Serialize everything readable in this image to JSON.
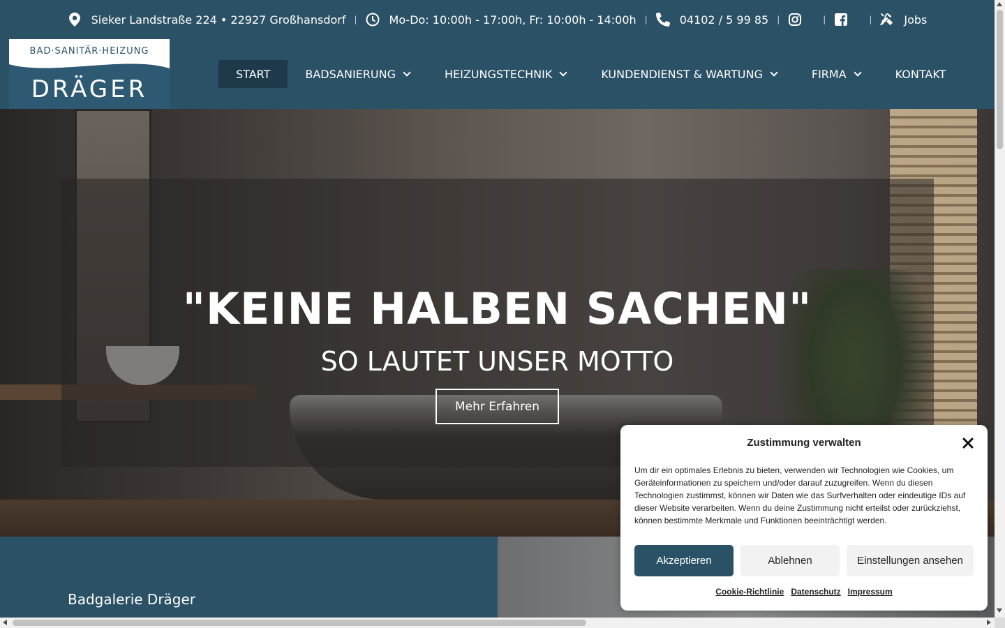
{
  "topbar": {
    "address": "Sieker Landstraße 224 • 22927 Großhansdorf",
    "hours": "Mo-Do: 10:00h - 17:00h, Fr: 10:00h - 14:00h",
    "phone": "04102 / 5 99 85",
    "jobs": "Jobs",
    "icons": [
      "map-pin-icon",
      "clock-icon",
      "phone-icon",
      "instagram-icon",
      "facebook-icon",
      "tools-icon"
    ]
  },
  "logo": {
    "small": "BAD·SANITÄR·HEIZUNG",
    "big": "DRÄGER"
  },
  "nav": {
    "items": [
      {
        "label": "START",
        "active": true
      },
      {
        "label": "BADSANIERUNG",
        "dropdown": true
      },
      {
        "label": "HEIZUNGSTECHNIK",
        "dropdown": true
      },
      {
        "label": "KUNDENDIENST & WARTUNG",
        "dropdown": true
      },
      {
        "label": "FIRMA",
        "dropdown": true
      },
      {
        "label": "KONTAKT"
      }
    ]
  },
  "hero": {
    "title": "\"KEINE HALBEN SACHEN\"",
    "subtitle": "SO LAUTET UNSER MOTTO",
    "button": "Mehr Erfahren"
  },
  "section": {
    "title": "Badgalerie Dräger"
  },
  "cookie": {
    "title": "Zustimmung verwalten",
    "text": "Um dir ein optimales Erlebnis zu bieten, verwenden wir Technologien wie Cookies, um Geräteinformationen zu speichern und/oder darauf zuzugreifen. Wenn du diesen Technologien zustimmst, können wir Daten wie das Surfverhalten oder eindeutige IDs auf dieser Website verarbeiten. Wenn du deine Zustimmung nicht erteilst oder zurückziehst, können bestimmte Merkmale und Funktionen beeinträchtigt werden.",
    "accept": "Akzeptieren",
    "deny": "Ablehnen",
    "settings": "Einstellungen ansehen",
    "links": [
      "Cookie-Richtlinie",
      "Datenschutz",
      "Impressum"
    ]
  },
  "colors": {
    "brand": "#2b5166",
    "nav_active": "#1e3a4a",
    "white": "#ffffff"
  }
}
